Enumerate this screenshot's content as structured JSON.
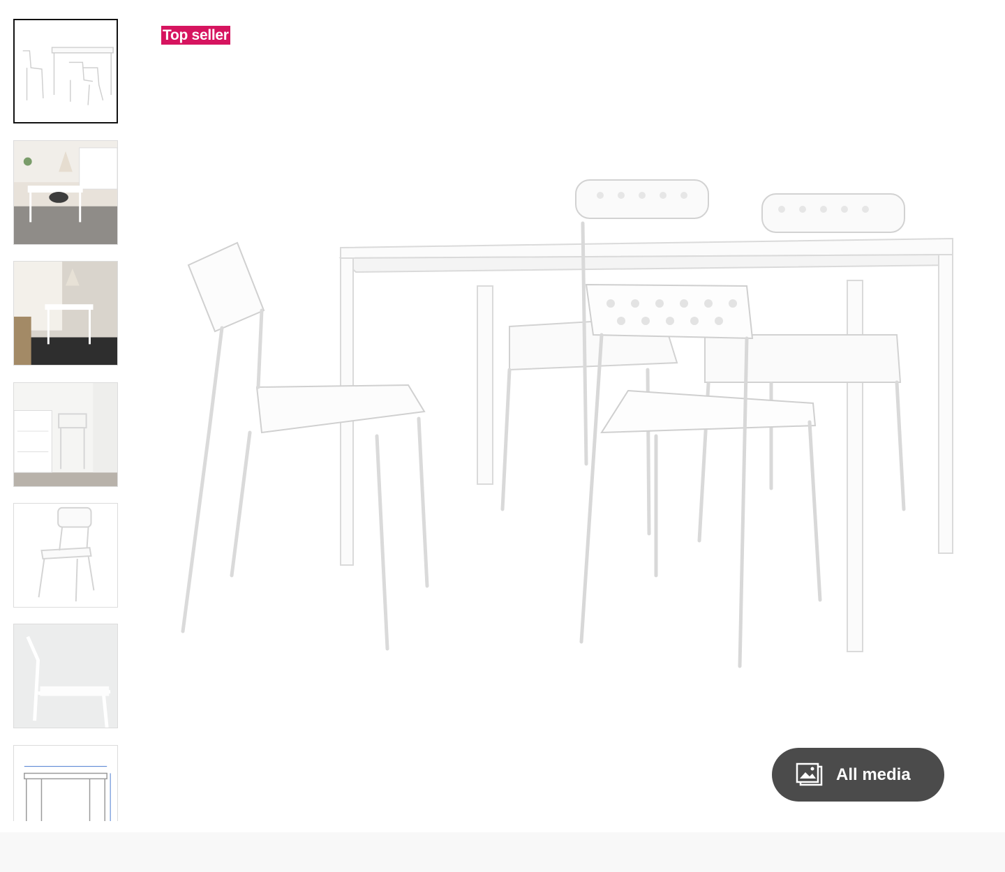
{
  "badge": {
    "label": "Top seller",
    "color": "#d6145f"
  },
  "gallery": {
    "all_media_label": "All media",
    "all_media_icon": "image-gallery-icon",
    "thumbnails": [
      {
        "name": "thumbnail-product-white",
        "selected": true
      },
      {
        "name": "thumbnail-kitchen-scene-1",
        "selected": false
      },
      {
        "name": "thumbnail-kitchen-scene-2",
        "selected": false
      },
      {
        "name": "thumbnail-stacked-chairs",
        "selected": false
      },
      {
        "name": "thumbnail-single-chair",
        "selected": false
      },
      {
        "name": "thumbnail-chair-detail",
        "selected": false
      },
      {
        "name": "thumbnail-dimensions-drawing",
        "selected": false
      }
    ]
  }
}
